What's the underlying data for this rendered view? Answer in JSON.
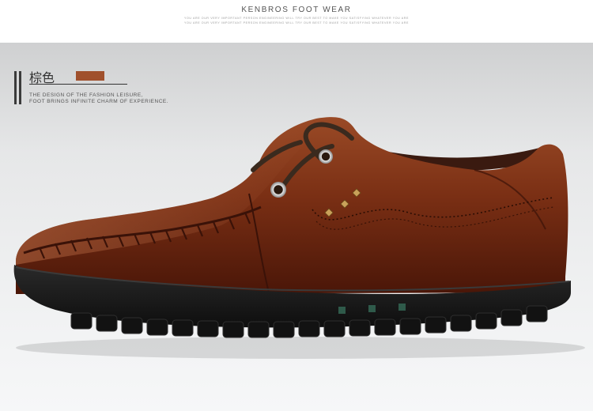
{
  "header": {
    "brand": "KENBROS FOOT WEAR",
    "tagline_1": "YOU ARE OUR VERY IMPORTANT PERSON ENGINEERING WILL TRY OUR BEST TO MAKE YOU SATISFYING WHATEVER YOU ARE",
    "tagline_2": "YOU ARE OUR VERY IMPORTANT PERSON ENGINEERING WILL TRY OUR BEST TO MAKE YOU SATISFYING WHATEVER YOU ARE"
  },
  "product": {
    "color_name": "棕色",
    "color_hex": "#a0502c",
    "description_line_1": "THE DESIGN OF THE FASHION LEISURE,",
    "description_line_2": "FOOT BRINGS INFINITE CHARM OF EXPERIENCE."
  },
  "image": {
    "subject": "shoe-photo",
    "upper_color": "#7a2f14",
    "sole_color": "#1a1a1a",
    "lace_color": "#3a2a1e"
  }
}
